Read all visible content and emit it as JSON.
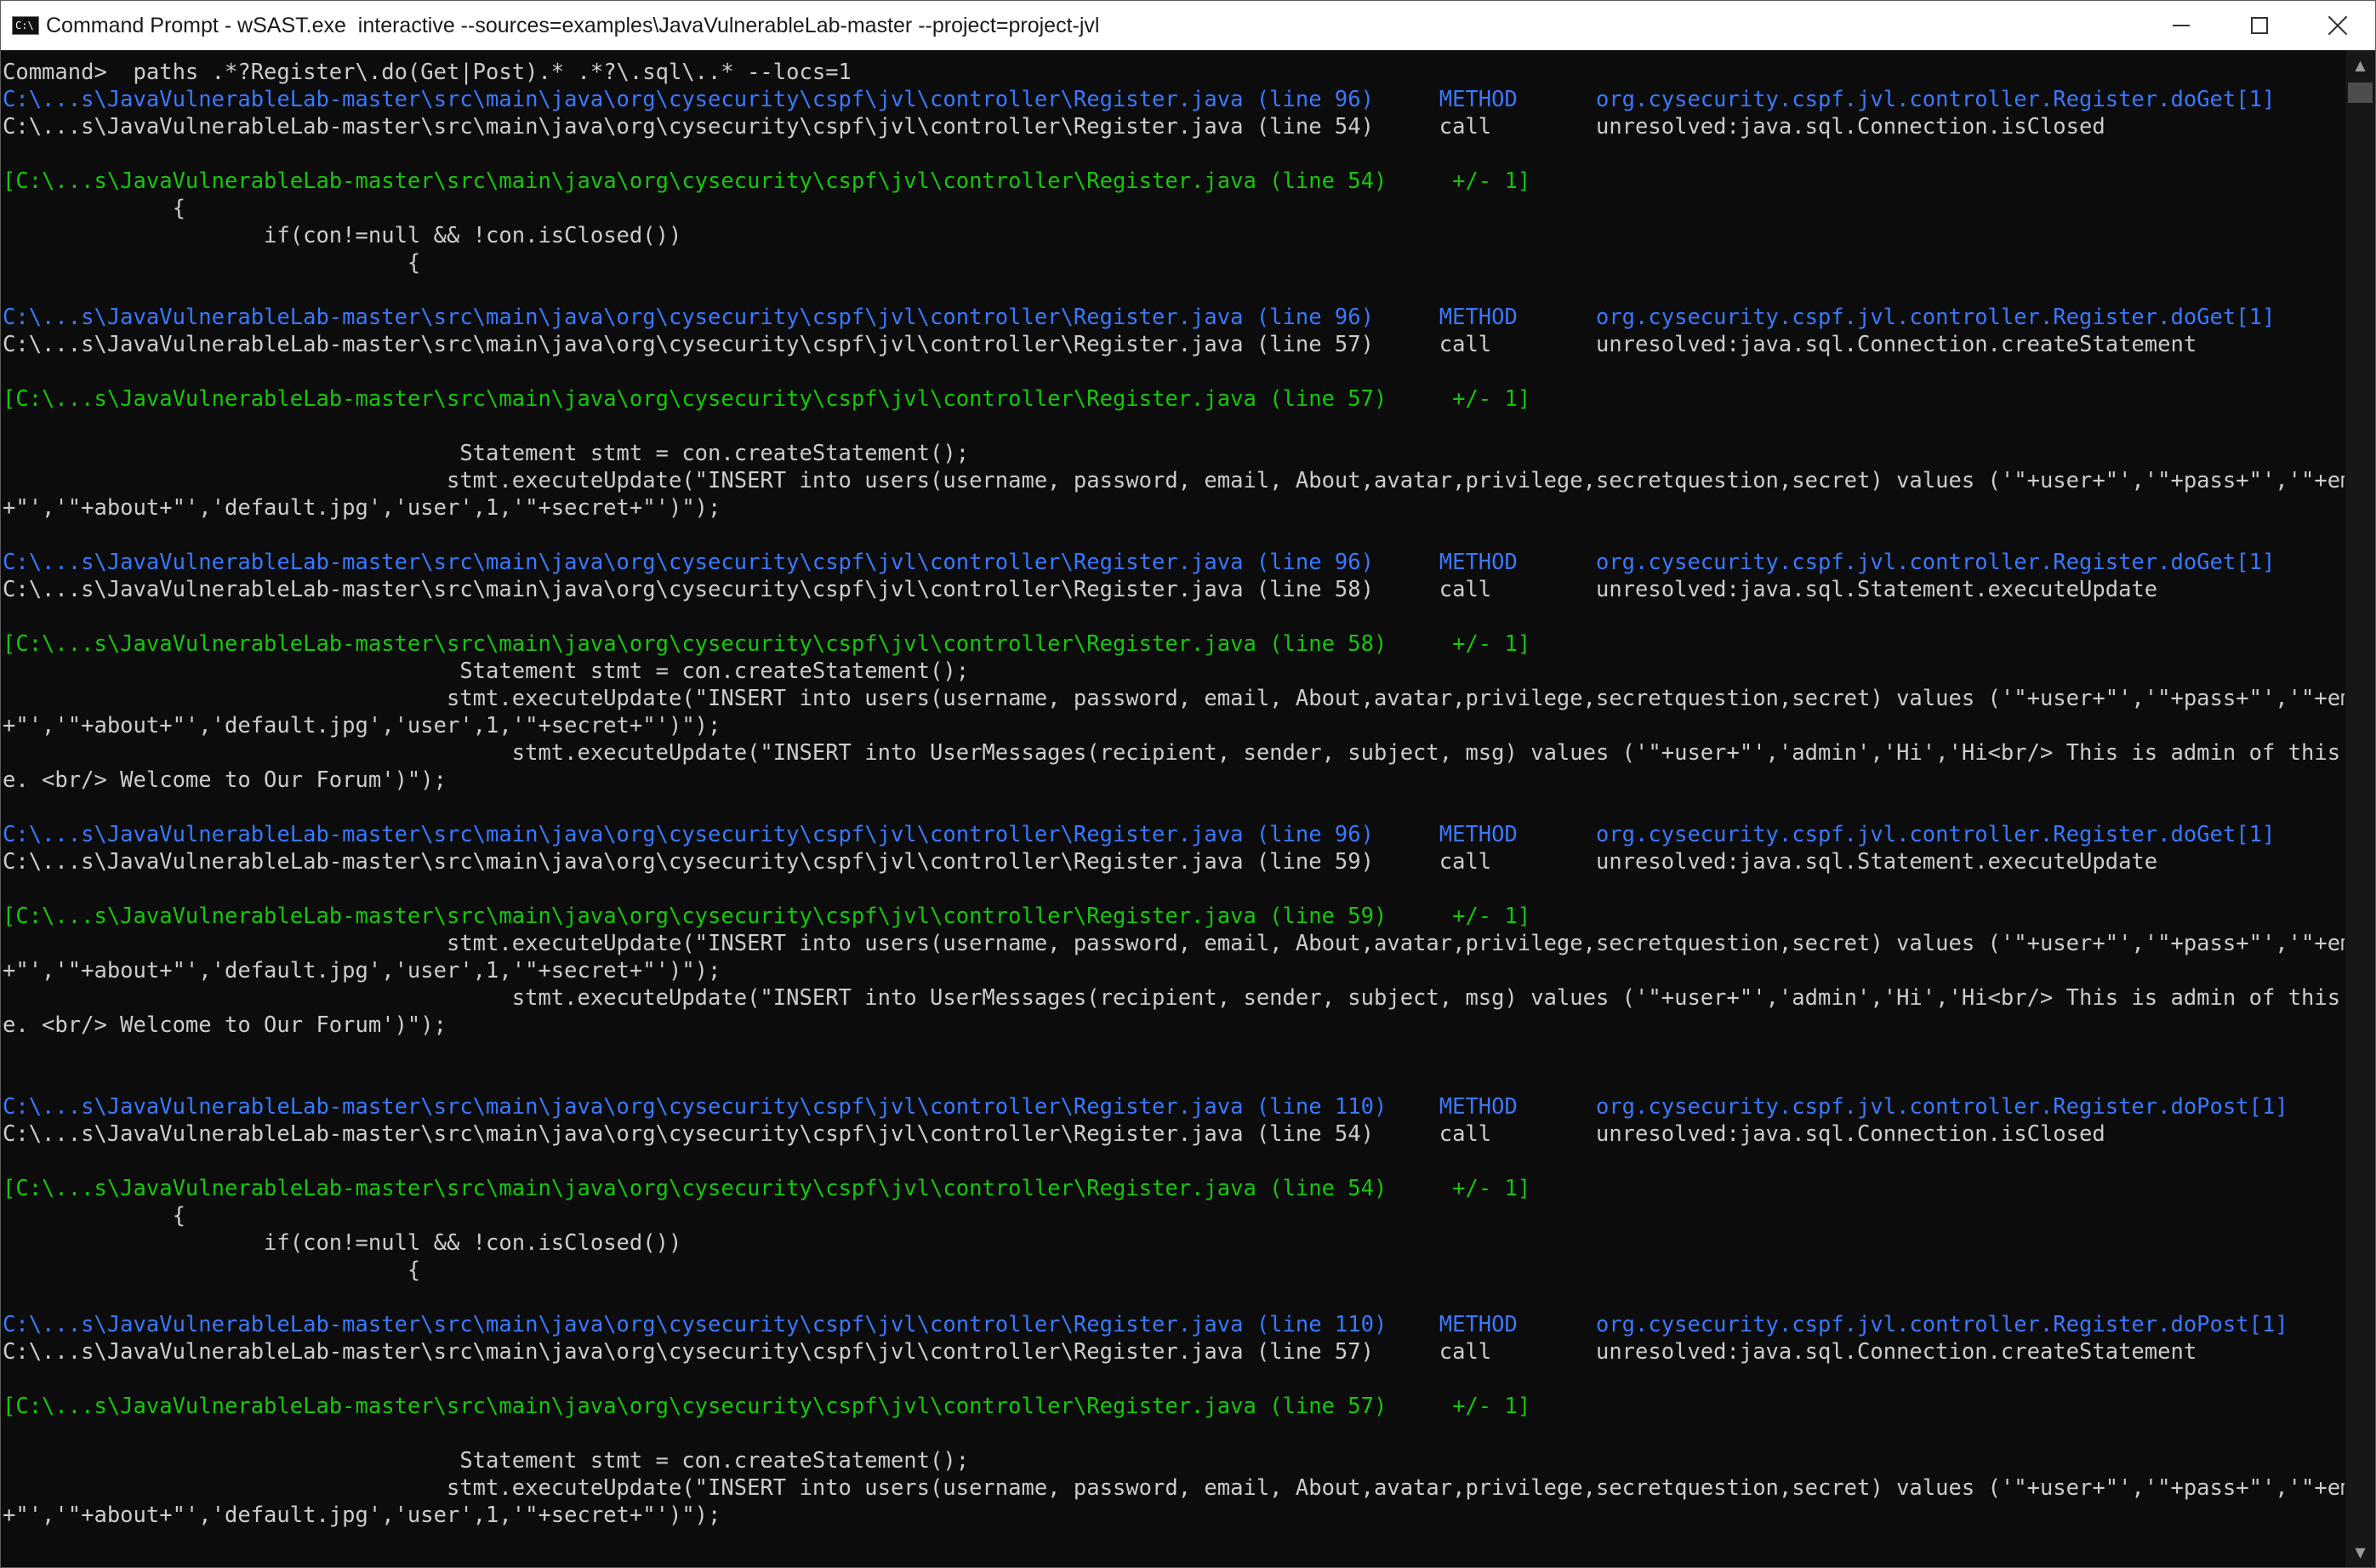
{
  "window": {
    "title": "Command Prompt - wSAST.exe  interactive --sources=examples\\JavaVulnerableLab-master --project=project-jvl",
    "icon_text": "C:\\"
  },
  "icons": {
    "app": "command-prompt-icon",
    "minimize": "minimize-icon",
    "maximize": "maximize-icon",
    "close": "close-icon",
    "scroll_up": "chevron-up-icon",
    "scroll_down": "chevron-down-icon"
  },
  "colors": {
    "background": "#0c0c0c",
    "text": "#cccccc",
    "path_blue": "#3b78ff",
    "context_green": "#16c60c"
  },
  "console": {
    "lines": [
      {
        "row": 0,
        "color": "plain",
        "text": "Command>  paths .*?Register\\.do(Get|Post).* .*?\\.sql\\..* --locs=1"
      },
      {
        "row": 1,
        "color": "blue",
        "text": "C:\\...s\\JavaVulnerableLab-master\\src\\main\\java\\org\\cysecurity\\cspf\\jvl\\controller\\Register.java (line 96)     METHOD      org.cysecurity.cspf.jvl.controller.Register.doGet[1]"
      },
      {
        "row": 2,
        "color": "plain",
        "text": "C:\\...s\\JavaVulnerableLab-master\\src\\main\\java\\org\\cysecurity\\cspf\\jvl\\controller\\Register.java (line 54)     call        unresolved:java.sql.Connection.isClosed"
      },
      {
        "row": 4,
        "color": "green",
        "text": "[C:\\...s\\JavaVulnerableLab-master\\src\\main\\java\\org\\cysecurity\\cspf\\jvl\\controller\\Register.java (line 54)     +/- 1]"
      },
      {
        "row": 5,
        "color": "plain",
        "text": "             {"
      },
      {
        "row": 6,
        "color": "plain",
        "text": "                    if(con!=null && !con.isClosed())"
      },
      {
        "row": 7,
        "color": "plain",
        "text": "                               {"
      },
      {
        "row": 9,
        "color": "blue",
        "text": "C:\\...s\\JavaVulnerableLab-master\\src\\main\\java\\org\\cysecurity\\cspf\\jvl\\controller\\Register.java (line 96)     METHOD      org.cysecurity.cspf.jvl.controller.Register.doGet[1]"
      },
      {
        "row": 10,
        "color": "plain",
        "text": "C:\\...s\\JavaVulnerableLab-master\\src\\main\\java\\org\\cysecurity\\cspf\\jvl\\controller\\Register.java (line 57)     call        unresolved:java.sql.Connection.createStatement"
      },
      {
        "row": 12,
        "color": "green",
        "text": "[C:\\...s\\JavaVulnerableLab-master\\src\\main\\java\\org\\cysecurity\\cspf\\jvl\\controller\\Register.java (line 57)     +/- 1]"
      },
      {
        "row": 14,
        "color": "plain",
        "text": "                                   Statement stmt = con.createStatement();"
      },
      {
        "row": 15,
        "color": "plain",
        "text": "                                  stmt.executeUpdate(\"INSERT into users(username, password, email, About,avatar,privilege,secretquestion,secret) values ('\"+user+\"','\"+pass+\"','\"+email"
      },
      {
        "row": 16,
        "color": "plain",
        "text": "+\"','\"+about+\"','default.jpg','user',1,'\"+secret+\"')\");"
      },
      {
        "row": 18,
        "color": "blue",
        "text": "C:\\...s\\JavaVulnerableLab-master\\src\\main\\java\\org\\cysecurity\\cspf\\jvl\\controller\\Register.java (line 96)     METHOD      org.cysecurity.cspf.jvl.controller.Register.doGet[1]"
      },
      {
        "row": 19,
        "color": "plain",
        "text": "C:\\...s\\JavaVulnerableLab-master\\src\\main\\java\\org\\cysecurity\\cspf\\jvl\\controller\\Register.java (line 58)     call        unresolved:java.sql.Statement.executeUpdate"
      },
      {
        "row": 21,
        "color": "green",
        "text": "[C:\\...s\\JavaVulnerableLab-master\\src\\main\\java\\org\\cysecurity\\cspf\\jvl\\controller\\Register.java (line 58)     +/- 1]"
      },
      {
        "row": 22,
        "color": "plain",
        "text": "                                   Statement stmt = con.createStatement();"
      },
      {
        "row": 23,
        "color": "plain",
        "text": "                                  stmt.executeUpdate(\"INSERT into users(username, password, email, About,avatar,privilege,secretquestion,secret) values ('\"+user+\"','\"+pass+\"','\"+email"
      },
      {
        "row": 24,
        "color": "plain",
        "text": "+\"','\"+about+\"','default.jpg','user',1,'\"+secret+\"')\");"
      },
      {
        "row": 25,
        "color": "plain",
        "text": "                                       stmt.executeUpdate(\"INSERT into UserMessages(recipient, sender, subject, msg) values ('\"+user+\"','admin','Hi','Hi<br/> This is admin of this pag"
      },
      {
        "row": 26,
        "color": "plain",
        "text": "e. <br/> Welcome to Our Forum')\");"
      },
      {
        "row": 28,
        "color": "blue",
        "text": "C:\\...s\\JavaVulnerableLab-master\\src\\main\\java\\org\\cysecurity\\cspf\\jvl\\controller\\Register.java (line 96)     METHOD      org.cysecurity.cspf.jvl.controller.Register.doGet[1]"
      },
      {
        "row": 29,
        "color": "plain",
        "text": "C:\\...s\\JavaVulnerableLab-master\\src\\main\\java\\org\\cysecurity\\cspf\\jvl\\controller\\Register.java (line 59)     call        unresolved:java.sql.Statement.executeUpdate"
      },
      {
        "row": 31,
        "color": "green",
        "text": "[C:\\...s\\JavaVulnerableLab-master\\src\\main\\java\\org\\cysecurity\\cspf\\jvl\\controller\\Register.java (line 59)     +/- 1]"
      },
      {
        "row": 32,
        "color": "plain",
        "text": "                                  stmt.executeUpdate(\"INSERT into users(username, password, email, About,avatar,privilege,secretquestion,secret) values ('\"+user+\"','\"+pass+\"','\"+email"
      },
      {
        "row": 33,
        "color": "plain",
        "text": "+\"','\"+about+\"','default.jpg','user',1,'\"+secret+\"')\");"
      },
      {
        "row": 34,
        "color": "plain",
        "text": "                                       stmt.executeUpdate(\"INSERT into UserMessages(recipient, sender, subject, msg) values ('\"+user+\"','admin','Hi','Hi<br/> This is admin of this pag"
      },
      {
        "row": 35,
        "color": "plain",
        "text": "e. <br/> Welcome to Our Forum')\");"
      },
      {
        "row": 38,
        "color": "blue",
        "text": "C:\\...s\\JavaVulnerableLab-master\\src\\main\\java\\org\\cysecurity\\cspf\\jvl\\controller\\Register.java (line 110)    METHOD      org.cysecurity.cspf.jvl.controller.Register.doPost[1]"
      },
      {
        "row": 39,
        "color": "plain",
        "text": "C:\\...s\\JavaVulnerableLab-master\\src\\main\\java\\org\\cysecurity\\cspf\\jvl\\controller\\Register.java (line 54)     call        unresolved:java.sql.Connection.isClosed"
      },
      {
        "row": 41,
        "color": "green",
        "text": "[C:\\...s\\JavaVulnerableLab-master\\src\\main\\java\\org\\cysecurity\\cspf\\jvl\\controller\\Register.java (line 54)     +/- 1]"
      },
      {
        "row": 42,
        "color": "plain",
        "text": "             {"
      },
      {
        "row": 43,
        "color": "plain",
        "text": "                    if(con!=null && !con.isClosed())"
      },
      {
        "row": 44,
        "color": "plain",
        "text": "                               {"
      },
      {
        "row": 46,
        "color": "blue",
        "text": "C:\\...s\\JavaVulnerableLab-master\\src\\main\\java\\org\\cysecurity\\cspf\\jvl\\controller\\Register.java (line 110)    METHOD      org.cysecurity.cspf.jvl.controller.Register.doPost[1]"
      },
      {
        "row": 47,
        "color": "plain",
        "text": "C:\\...s\\JavaVulnerableLab-master\\src\\main\\java\\org\\cysecurity\\cspf\\jvl\\controller\\Register.java (line 57)     call        unresolved:java.sql.Connection.createStatement"
      },
      {
        "row": 49,
        "color": "green",
        "text": "[C:\\...s\\JavaVulnerableLab-master\\src\\main\\java\\org\\cysecurity\\cspf\\jvl\\controller\\Register.java (line 57)     +/- 1]"
      },
      {
        "row": 51,
        "color": "plain",
        "text": "                                   Statement stmt = con.createStatement();"
      },
      {
        "row": 52,
        "color": "plain",
        "text": "                                  stmt.executeUpdate(\"INSERT into users(username, password, email, About,avatar,privilege,secretquestion,secret) values ('\"+user+\"','\"+pass+\"','\"+email"
      },
      {
        "row": 53,
        "color": "plain",
        "text": "+\"','\"+about+\"','default.jpg','user',1,'\"+secret+\"')\");"
      }
    ]
  }
}
